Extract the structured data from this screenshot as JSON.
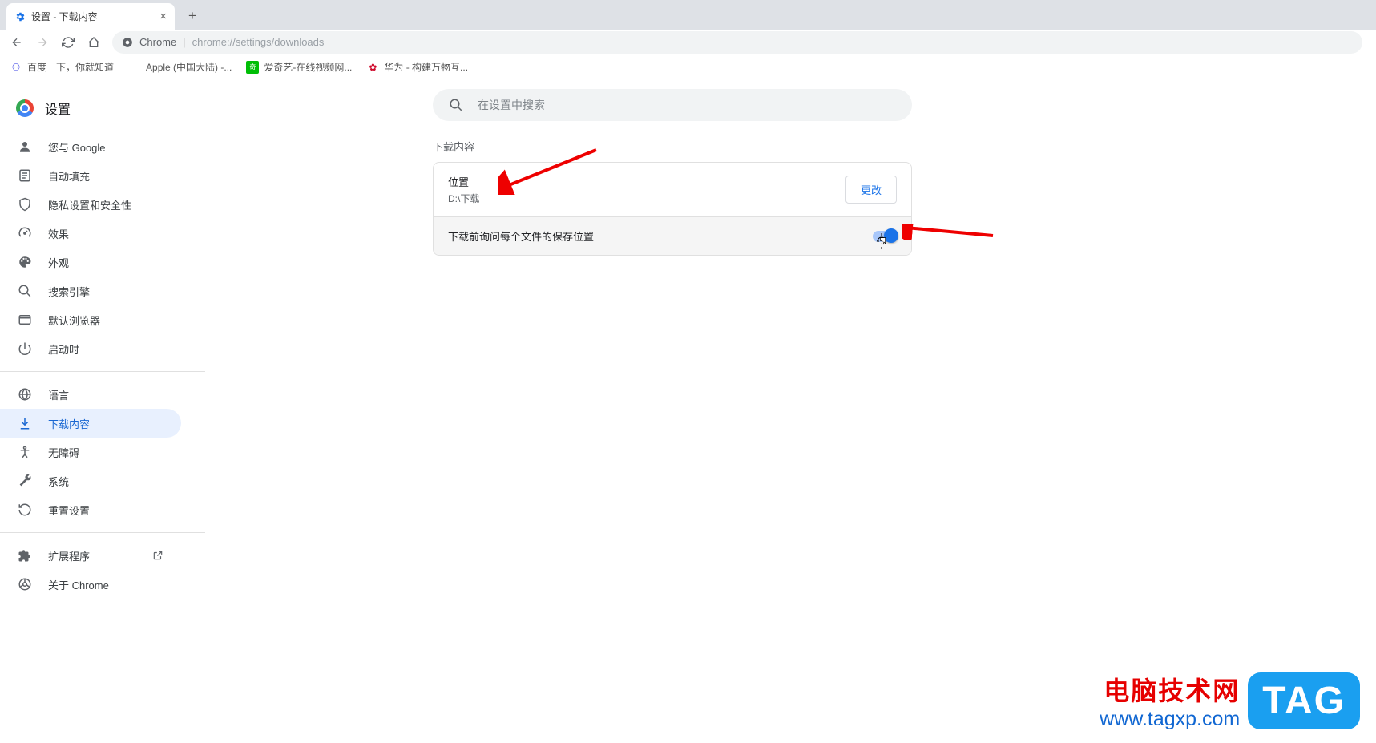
{
  "tab": {
    "title": "设置 - 下载内容"
  },
  "url": {
    "site": "Chrome",
    "path": "chrome://settings/downloads"
  },
  "bookmarks": [
    {
      "label": "百度一下，你就知道",
      "iconColor": "#2932e1"
    },
    {
      "label": "Apple (中国大陆) -...",
      "iconColor": "#555"
    },
    {
      "label": "爱奇艺-在线视频网...",
      "iconColor": "#00be06"
    },
    {
      "label": "华为 - 构建万物互...",
      "iconColor": "#cf0a2c"
    }
  ],
  "sidebar": {
    "title": "设置",
    "items": [
      {
        "label": "您与 Google"
      },
      {
        "label": "自动填充"
      },
      {
        "label": "隐私设置和安全性"
      },
      {
        "label": "效果"
      },
      {
        "label": "外观"
      },
      {
        "label": "搜索引擎"
      },
      {
        "label": "默认浏览器"
      },
      {
        "label": "启动时"
      }
    ],
    "items2": [
      {
        "label": "语言"
      },
      {
        "label": "下载内容"
      },
      {
        "label": "无障碍"
      },
      {
        "label": "系统"
      },
      {
        "label": "重置设置"
      }
    ],
    "items3": [
      {
        "label": "扩展程序"
      },
      {
        "label": "关于 Chrome"
      }
    ]
  },
  "search": {
    "placeholder": "在设置中搜索"
  },
  "section": {
    "title": "下载内容",
    "location_label": "位置",
    "location_path": "D:\\下载",
    "change_btn": "更改",
    "ask_label": "下载前询问每个文件的保存位置"
  },
  "watermark": {
    "title": "电脑技术网",
    "url": "www.tagxp.com",
    "tag": "TAG"
  }
}
